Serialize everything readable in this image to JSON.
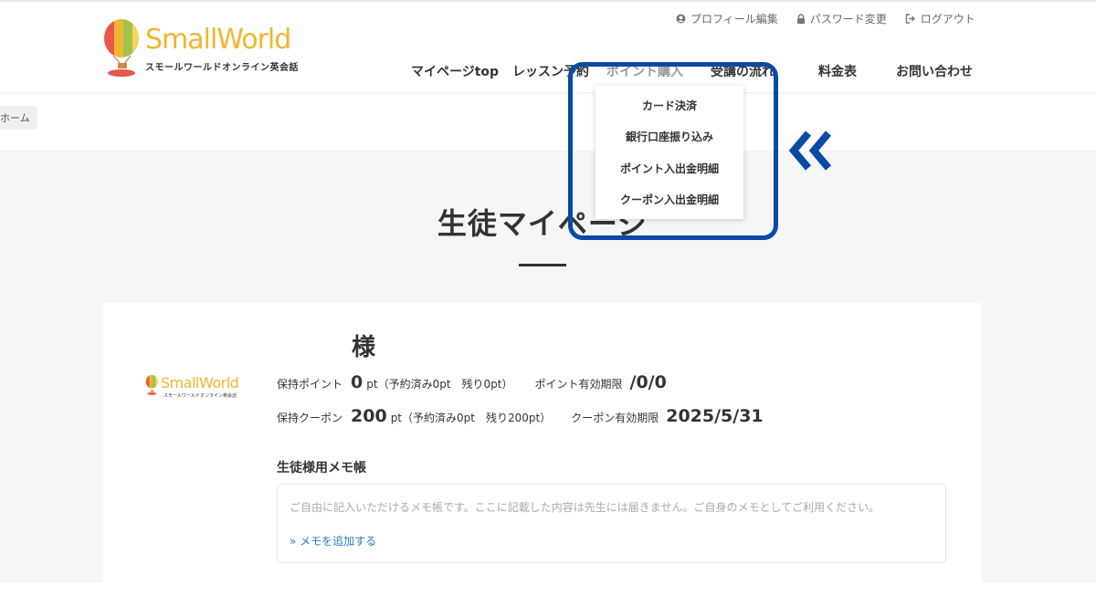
{
  "brand": {
    "name": "SmallWorld",
    "tagline": "スモールワールドオンライン英会話",
    "colors": {
      "yellow": "#f2b531",
      "accent_blue": "#0a4aa6",
      "link_blue": "#2a7ac8"
    }
  },
  "util_links": [
    {
      "icon": "user-icon",
      "label": "プロフィール編集"
    },
    {
      "icon": "lock-icon",
      "label": "パスワード変更"
    },
    {
      "icon": "logout-icon",
      "label": "ログアウト"
    }
  ],
  "nav": [
    {
      "label": "マイページtop"
    },
    {
      "label": "レッスン予約"
    },
    {
      "label": "ポイント購入"
    },
    {
      "label": "受講の流れ"
    },
    {
      "label": "料金表"
    },
    {
      "label": "お問い合わせ"
    }
  ],
  "dropdown": [
    {
      "label": "カード決済"
    },
    {
      "label": "銀行口座振り込み"
    },
    {
      "label": "ポイント入出金明細"
    },
    {
      "label": "クーポン入出金明細"
    }
  ],
  "breadcrumb": {
    "home": "ホーム"
  },
  "page": {
    "title": "生徒マイページ"
  },
  "profile": {
    "name_suffix": "様",
    "points": {
      "label": "保持ポイント",
      "value": "0",
      "unit_detail": "pt（予約済み0pt　残り0pt）",
      "expiry_label": "ポイント有効期限",
      "expiry_value": "/0/0"
    },
    "coupons": {
      "label": "保持クーポン",
      "value": "200",
      "unit_detail": "pt（予約済み0pt　残り200pt）",
      "expiry_label": "クーポン有効期限",
      "expiry_value": "2025/5/31"
    }
  },
  "memo": {
    "heading": "生徒様用メモ帳",
    "placeholder": "ご自由に記入いただけるメモ帳です。ここに記載した内容は先生には届きません。ご自身のメモとしてご利用ください。",
    "add_link": "» メモを追加する"
  }
}
